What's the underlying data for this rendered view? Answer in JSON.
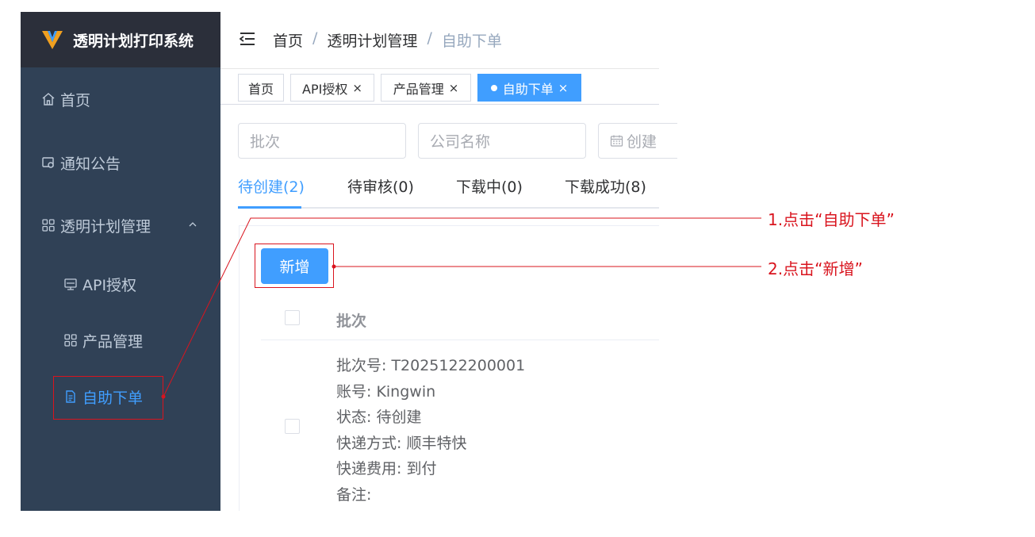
{
  "app": {
    "title": "透明计划打印系统"
  },
  "sidebar": {
    "items": [
      {
        "label": "首页",
        "icon": "home-icon"
      },
      {
        "label": "通知公告",
        "icon": "notice-icon"
      },
      {
        "label": "透明计划管理",
        "icon": "grid-icon",
        "expanded": true
      },
      {
        "label": "API授权",
        "icon": "monitor-icon"
      },
      {
        "label": "产品管理",
        "icon": "grid-icon"
      },
      {
        "label": "自助下单",
        "icon": "document-icon",
        "active": true
      }
    ]
  },
  "breadcrumb": [
    "首页",
    "透明计划管理",
    "自助下单"
  ],
  "tags": [
    {
      "label": "首页"
    },
    {
      "label": "API授权",
      "close": "×"
    },
    {
      "label": "产品管理",
      "close": "×"
    },
    {
      "label": "自助下单",
      "close": "×",
      "active": true
    }
  ],
  "search": {
    "batch_placeholder": "批次",
    "company_placeholder": "公司名称",
    "date_placeholder": "创建"
  },
  "status_tabs": [
    {
      "label": "待创建(2)",
      "active": true
    },
    {
      "label": "待审核(0)"
    },
    {
      "label": "下载中(0)"
    },
    {
      "label": "下载成功(8)"
    }
  ],
  "toolbar": {
    "add_label": "新增"
  },
  "table": {
    "header": "批次",
    "rows": [
      {
        "lines": [
          "批次号: T2025122200001",
          "账号: Kingwin",
          "状态: 待创建",
          "快递方式: 顺丰特快",
          "快递费用: 到付",
          "备注:"
        ]
      }
    ]
  },
  "annotations": {
    "step1": "1.点击“自助下单”",
    "step2": "2.点击“新增”"
  },
  "colors": {
    "sidebar_bg": "#304156",
    "logo_bg": "#2b2f3a",
    "primary": "#409eff",
    "annotation": "#d9141e"
  }
}
